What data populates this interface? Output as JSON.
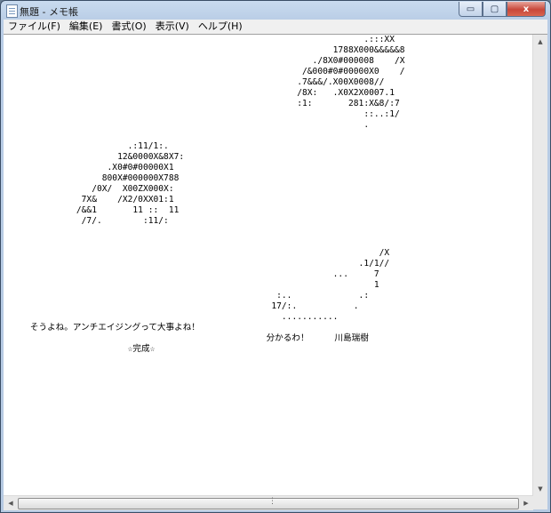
{
  "window": {
    "title": "無題 - メモ帳",
    "caption_buttons": {
      "minimize": "▭",
      "maximize": "▢",
      "close": "x"
    }
  },
  "menu": [
    "ファイル(F)",
    "編集(E)",
    "書式(O)",
    "表示(V)",
    "ヘルプ(H)"
  ],
  "editor": {
    "lines": [
      "                                                                      .:::XX",
      "                                                                1788X000&&&&&8",
      "                                                            ./8X0#000008    /X",
      "                                                          /&000#0#00000X0    /",
      "                                                         .7&&&/.X00X0008//",
      "                                                         /8X:   .X0X2X0007.1",
      "                                                         :1:       281:X&8/:7",
      "                                                                      ::..:1/",
      "                                                                      .",
      "",
      "                        .:11/1:.",
      "                      12&0000X&8X7:",
      "                    .X0#0#00000X1",
      "                   800X#000000X788",
      "                 /0X/  X00ZX000X:",
      "               7X&    /X2/0XX01:1",
      "              /&&1       11 ::  11",
      "               /7/.        :11/:",
      "",
      "",
      "                                                                         /X",
      "                                                                     .1/1//",
      "                                                                ...     7",
      "                                                                        1",
      "                                                     :..             .:",
      "                                                    17/:.           .",
      "                                                      ...........",
      "     そうよね。アンチエイジングって大事よね！",
      "                                                   分かるわ！     川島瑞樹",
      "                        ☆完成☆"
    ]
  },
  "scrollbar": {
    "up": "▲",
    "down": "▼",
    "left": "◀",
    "right": "▶",
    "grip": "⋮"
  }
}
